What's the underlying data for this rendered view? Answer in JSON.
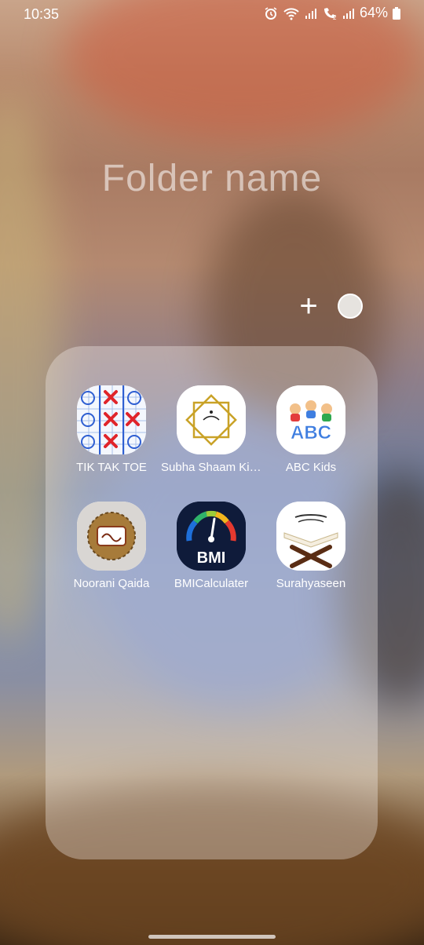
{
  "status_bar": {
    "time": "10:35",
    "battery": "64%",
    "icons": [
      "alarm-icon",
      "wifi-icon",
      "signal-icon",
      "volte-icon",
      "signal-icon",
      "battery-icon"
    ]
  },
  "folder": {
    "name_placeholder": "Folder name",
    "add_icon": "+",
    "color_selector": "#e6e3df"
  },
  "apps": [
    {
      "label": "TIK TAK TOE",
      "icon": "tic-tac-toe-icon"
    },
    {
      "label": "Subha Shaam Ki ...",
      "icon": "subha-shaam-icon"
    },
    {
      "label": "ABC Kids",
      "icon": "abc-kids-icon"
    },
    {
      "label": "Noorani Qaida",
      "icon": "noorani-qaida-icon"
    },
    {
      "label": "BMICalculater",
      "icon": "bmi-calculator-icon"
    },
    {
      "label": "Surahyaseen",
      "icon": "surah-yaseen-icon"
    }
  ],
  "bmi_icon_text": "BMI",
  "abc_icon_text": "ABC"
}
